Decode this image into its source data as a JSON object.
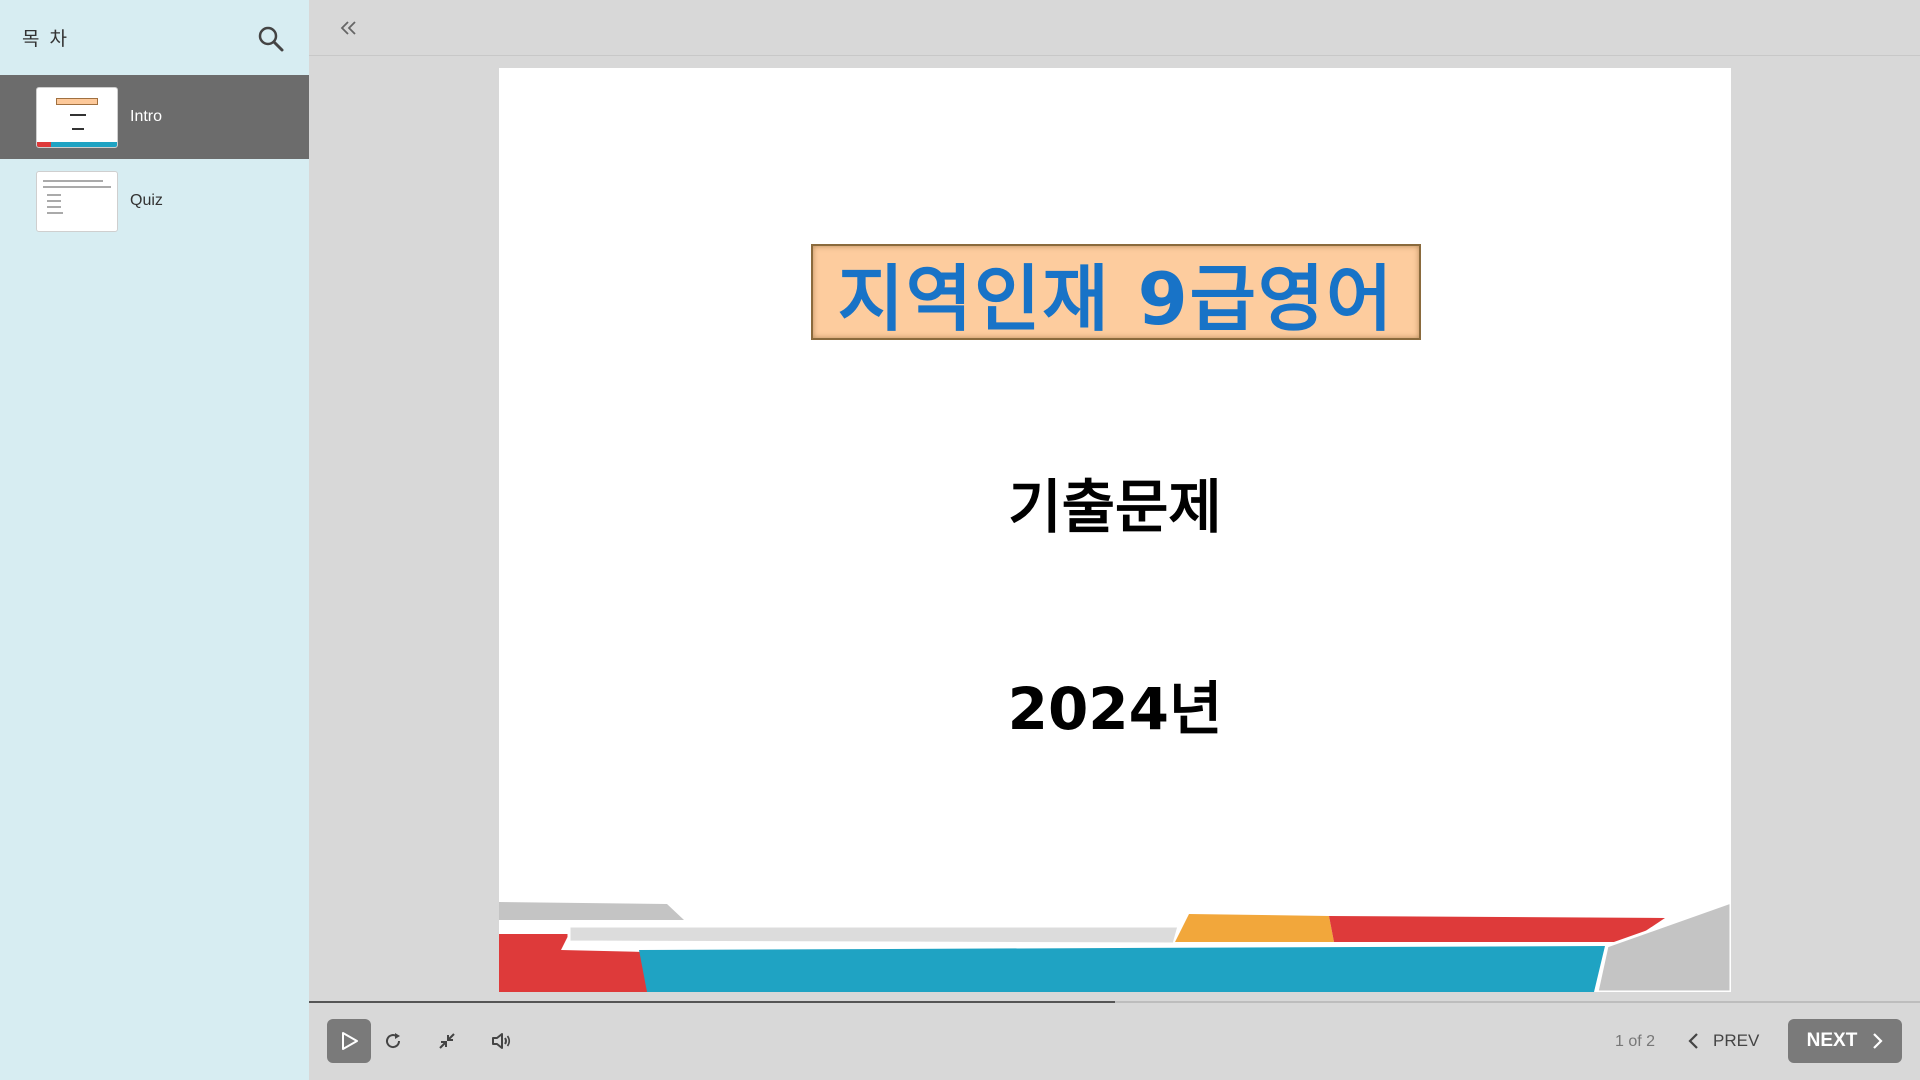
{
  "sidebar": {
    "title": "목 차",
    "items": [
      {
        "label": "Intro",
        "active": true
      },
      {
        "label": "Quiz",
        "active": false
      }
    ]
  },
  "slide": {
    "title": "지역인재 9급영어",
    "subtitle": "기출문제",
    "year": "2024년"
  },
  "player": {
    "page_indicator": "1 of 2",
    "prev_label": "PREV",
    "next_label": "NEXT",
    "progress": 0.5
  },
  "colors": {
    "sidebar_bg": "#d7edf2",
    "title_fill": "#fdcc9e",
    "title_text": "#1873c7",
    "accent_red": "#de3a3a",
    "accent_blue": "#1fa3c3",
    "accent_orange": "#f2a73b",
    "button_gray": "#7a7a7a"
  }
}
